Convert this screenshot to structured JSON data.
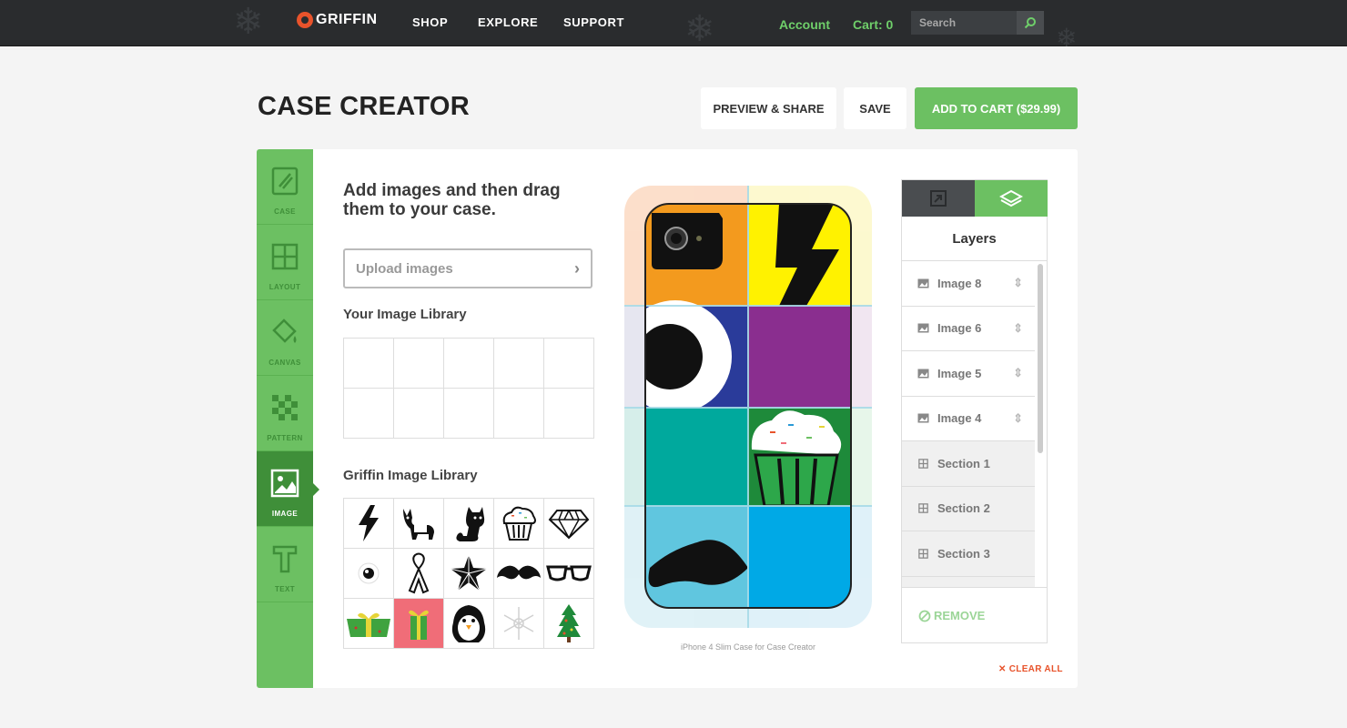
{
  "nav": {
    "logo_text": "GRIFFIN",
    "links": [
      "SHOP",
      "EXPLORE",
      "SUPPORT"
    ],
    "account": "Account",
    "cart": "Cart: 0",
    "search_placeholder": "Search"
  },
  "header": {
    "title": "CASE CREATOR",
    "preview_share": "PREVIEW & SHARE",
    "save": "SAVE",
    "add_to_cart": "ADD TO CART ($29.99)"
  },
  "sidebar": {
    "items": [
      {
        "label": "CASE",
        "icon": "case-icon"
      },
      {
        "label": "LAYOUT",
        "icon": "layout-icon"
      },
      {
        "label": "CANVAS",
        "icon": "paint-bucket-icon"
      },
      {
        "label": "PATTERN",
        "icon": "checker-pattern-icon"
      },
      {
        "label": "IMAGE",
        "icon": "image-icon",
        "active": true
      },
      {
        "label": "TEXT",
        "icon": "text-icon"
      }
    ]
  },
  "images_panel": {
    "instruction": "Add images and then drag them to your case.",
    "upload_placeholder": "Upload images",
    "your_library_label": "Your Image Library",
    "griffin_library_label": "Griffin Image Library",
    "griffin_library": [
      "lightning-bolt-icon",
      "boston-terrier-icon",
      "cat-icon",
      "cupcake-icon",
      "diamond-icon",
      "eyeball-icon",
      "ribbon-icon",
      "nautical-star-icon",
      "mustache-icon",
      "glasses-icon",
      "green-gift-icon",
      "red-gift-icon",
      "penguin-icon",
      "snowflake-icon",
      "christmas-tree-icon"
    ]
  },
  "phone": {
    "caption": "iPhone 4 Slim Case for Case Creator"
  },
  "layers": {
    "title": "Layers",
    "rows": [
      {
        "label": "Image 8",
        "type": "image"
      },
      {
        "label": "Image 6",
        "type": "image"
      },
      {
        "label": "Image 5",
        "type": "image"
      },
      {
        "label": "Image 4",
        "type": "image"
      },
      {
        "label": "Section 1",
        "type": "section"
      },
      {
        "label": "Section 2",
        "type": "section"
      },
      {
        "label": "Section 3",
        "type": "section"
      }
    ],
    "remove": "REMOVE",
    "clear_all": "CLEAR ALL"
  },
  "colors": {
    "accent_green": "#6cc062",
    "active_green": "#3f8f39",
    "nav_bg": "#2a2c2e",
    "clear_red": "#e8532b"
  }
}
